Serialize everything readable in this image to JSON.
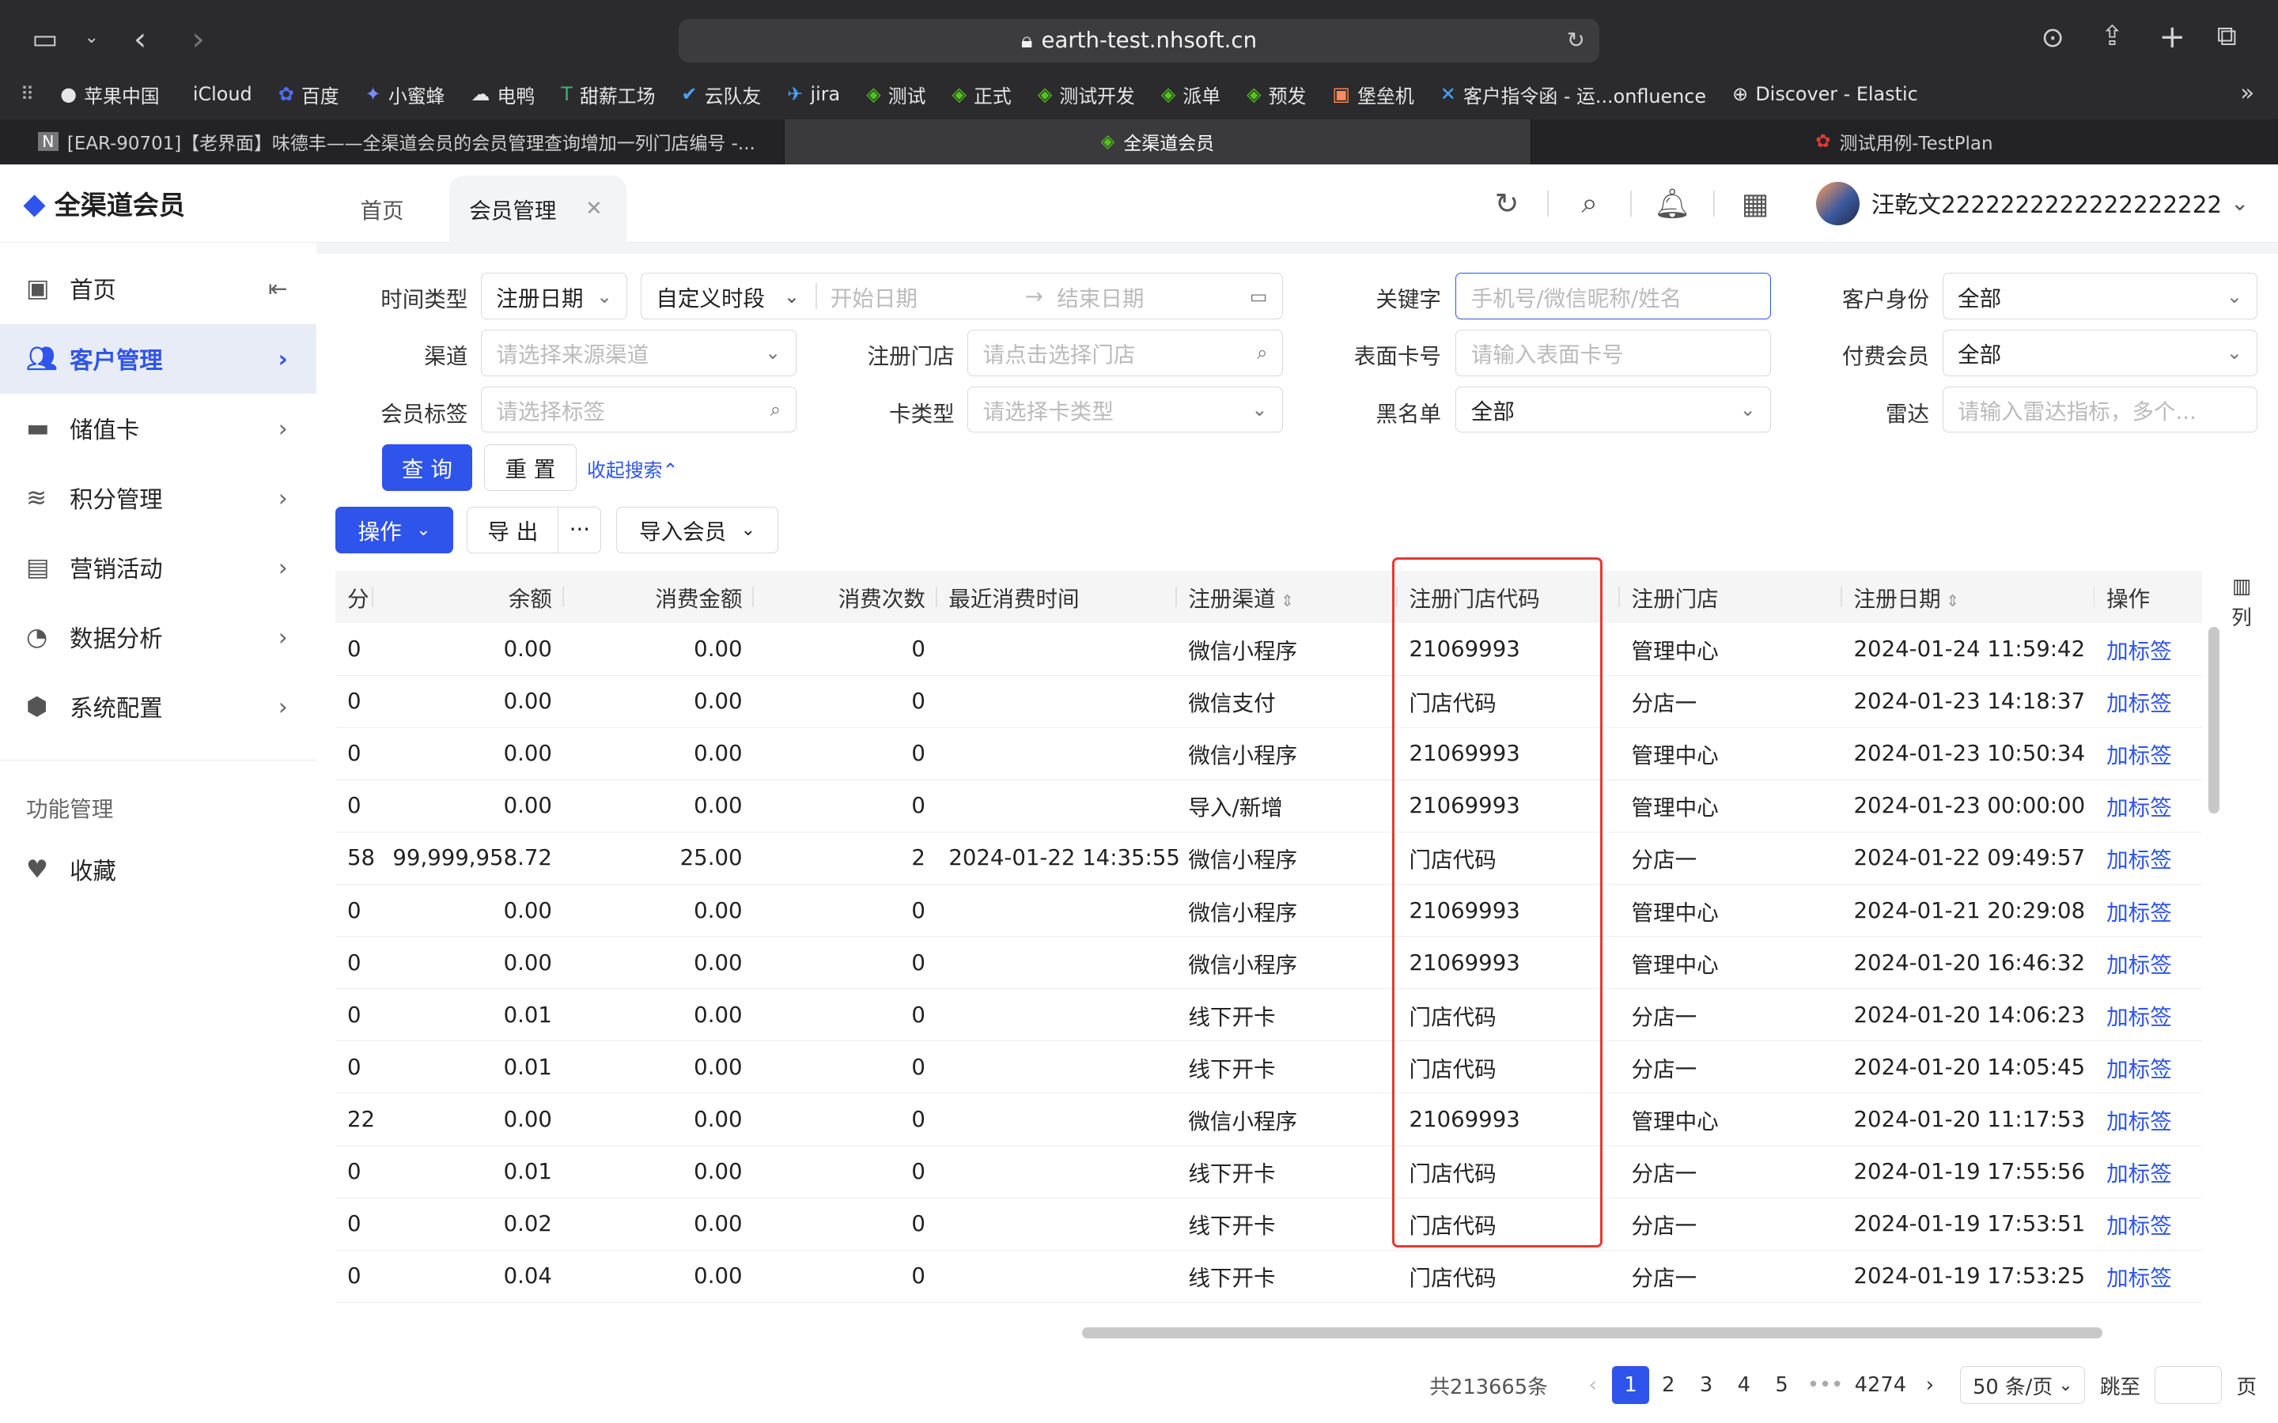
{
  "browser": {
    "url": "earth-test.nhsoft.cn",
    "bookmarks": [
      {
        "label": "苹果中国",
        "icon": "apple-icon"
      },
      {
        "label": "iCloud",
        "icon": "apple-icon"
      },
      {
        "label": "百度",
        "icon": "baidu-icon"
      },
      {
        "label": "小蜜蜂",
        "icon": "bee-icon"
      },
      {
        "label": "电鸭",
        "icon": "duck-icon"
      },
      {
        "label": "甜薪工场",
        "icon": "t-icon"
      },
      {
        "label": "云队友",
        "icon": "cloud-icon"
      },
      {
        "label": "jira",
        "icon": "jira-icon"
      },
      {
        "label": "测试",
        "icon": "diamond-icon"
      },
      {
        "label": "正式",
        "icon": "diamond-icon"
      },
      {
        "label": "测试开发",
        "icon": "diamond-icon"
      },
      {
        "label": "派单",
        "icon": "diamond-icon"
      },
      {
        "label": "预发",
        "icon": "diamond-icon"
      },
      {
        "label": "堡垒机",
        "icon": "server-icon"
      },
      {
        "label": "客户指令函 - 运...onfluence",
        "icon": "confluence-icon"
      },
      {
        "label": "Discover - Elastic",
        "icon": "globe-icon"
      }
    ],
    "tabs": [
      {
        "label": "[EAR-90701]【老界面】味德丰——全渠道会员的会员管理查询增加一列门店编号 -...",
        "icon": "N"
      },
      {
        "label": "全渠道会员",
        "icon": "◆"
      },
      {
        "label": "测试用例-TestPlan",
        "icon": "✿"
      }
    ]
  },
  "app": {
    "name": "全渠道会员",
    "page_tabs": [
      "首页",
      "会员管理"
    ],
    "user": "汪乾文2222222222222222222"
  },
  "sidebar": {
    "items": [
      {
        "label": "首页",
        "icon": "home-icon"
      },
      {
        "label": "客户管理",
        "icon": "users-icon"
      },
      {
        "label": "储值卡",
        "icon": "card-icon"
      },
      {
        "label": "积分管理",
        "icon": "coins-icon"
      },
      {
        "label": "营销活动",
        "icon": "chart-icon"
      },
      {
        "label": "数据分析",
        "icon": "pie-icon"
      },
      {
        "label": "系统配置",
        "icon": "hex-icon"
      }
    ],
    "group": "功能管理",
    "fav": "收藏"
  },
  "filters": {
    "time_type_label": "时间类型",
    "time_type": "注册日期",
    "period": "自定义时段",
    "start_ph": "开始日期",
    "end_ph": "结束日期",
    "keyword_label": "关键字",
    "keyword_ph": "手机号/微信昵称/姓名",
    "identity_label": "客户身份",
    "identity": "全部",
    "channel_label": "渠道",
    "channel_ph": "请选择来源渠道",
    "store_label": "注册门店",
    "store_ph": "请点击选择门店",
    "cardno_label": "表面卡号",
    "cardno_ph": "请输入表面卡号",
    "paid_label": "付费会员",
    "paid": "全部",
    "tag_label": "会员标签",
    "tag_ph": "请选择标签",
    "cardtype_label": "卡类型",
    "cardtype_ph": "请选择卡类型",
    "blacklist_label": "黑名单",
    "blacklist": "全部",
    "radar_label": "雷达",
    "radar_ph": "请输入雷达指标，多个...",
    "query": "查 询",
    "reset": "重 置",
    "collapse": "收起搜索"
  },
  "toolbar": {
    "operate": "操作",
    "export": "导 出",
    "more": "···",
    "import": "导入会员"
  },
  "table": {
    "headers": [
      "分",
      "余额",
      "消费金额",
      "消费次数",
      "最近消费时间",
      "注册渠道",
      "注册门店代码",
      "注册门店",
      "注册日期",
      "操作"
    ],
    "rows": [
      [
        "0",
        "0.00",
        "0.00",
        "0",
        "",
        "微信小程序",
        "21069993",
        "管理中心",
        "2024-01-24 11:59:42",
        "加标签"
      ],
      [
        "0",
        "0.00",
        "0.00",
        "0",
        "",
        "微信支付",
        "门店代码",
        "分店一",
        "2024-01-23 14:18:37",
        "加标签"
      ],
      [
        "0",
        "0.00",
        "0.00",
        "0",
        "",
        "微信小程序",
        "21069993",
        "管理中心",
        "2024-01-23 10:50:34",
        "加标签"
      ],
      [
        "0",
        "0.00",
        "0.00",
        "0",
        "",
        "导入/新增",
        "21069993",
        "管理中心",
        "2024-01-23 00:00:00",
        "加标签"
      ],
      [
        "58",
        "99,999,958.72",
        "25.00",
        "2",
        "2024-01-22 14:35:55",
        "微信小程序",
        "门店代码",
        "分店一",
        "2024-01-22 09:49:57",
        "加标签"
      ],
      [
        "0",
        "0.00",
        "0.00",
        "0",
        "",
        "微信小程序",
        "21069993",
        "管理中心",
        "2024-01-21 20:29:08",
        "加标签"
      ],
      [
        "0",
        "0.00",
        "0.00",
        "0",
        "",
        "微信小程序",
        "21069993",
        "管理中心",
        "2024-01-20 16:46:32",
        "加标签"
      ],
      [
        "0",
        "0.01",
        "0.00",
        "0",
        "",
        "线下开卡",
        "门店代码",
        "分店一",
        "2024-01-20 14:06:23",
        "加标签"
      ],
      [
        "0",
        "0.01",
        "0.00",
        "0",
        "",
        "线下开卡",
        "门店代码",
        "分店一",
        "2024-01-20 14:05:45",
        "加标签"
      ],
      [
        "22",
        "0.00",
        "0.00",
        "0",
        "",
        "微信小程序",
        "21069993",
        "管理中心",
        "2024-01-20 11:17:53",
        "加标签"
      ],
      [
        "0",
        "0.01",
        "0.00",
        "0",
        "",
        "线下开卡",
        "门店代码",
        "分店一",
        "2024-01-19 17:55:56",
        "加标签"
      ],
      [
        "0",
        "0.02",
        "0.00",
        "0",
        "",
        "线下开卡",
        "门店代码",
        "分店一",
        "2024-01-19 17:53:51",
        "加标签"
      ],
      [
        "0",
        "0.04",
        "0.00",
        "0",
        "",
        "线下开卡",
        "门店代码",
        "分店一",
        "2024-01-19 17:53:25",
        "加标签"
      ]
    ],
    "col_setting": "列"
  },
  "pagination": {
    "total": "共213665条",
    "pages": [
      "1",
      "2",
      "3",
      "4",
      "5",
      "•••",
      "4274"
    ],
    "size": "50 条/页",
    "jump": "跳至",
    "unit": "页"
  },
  "colors": {
    "accent": "#2f54eb",
    "highlight": "#e53935"
  }
}
